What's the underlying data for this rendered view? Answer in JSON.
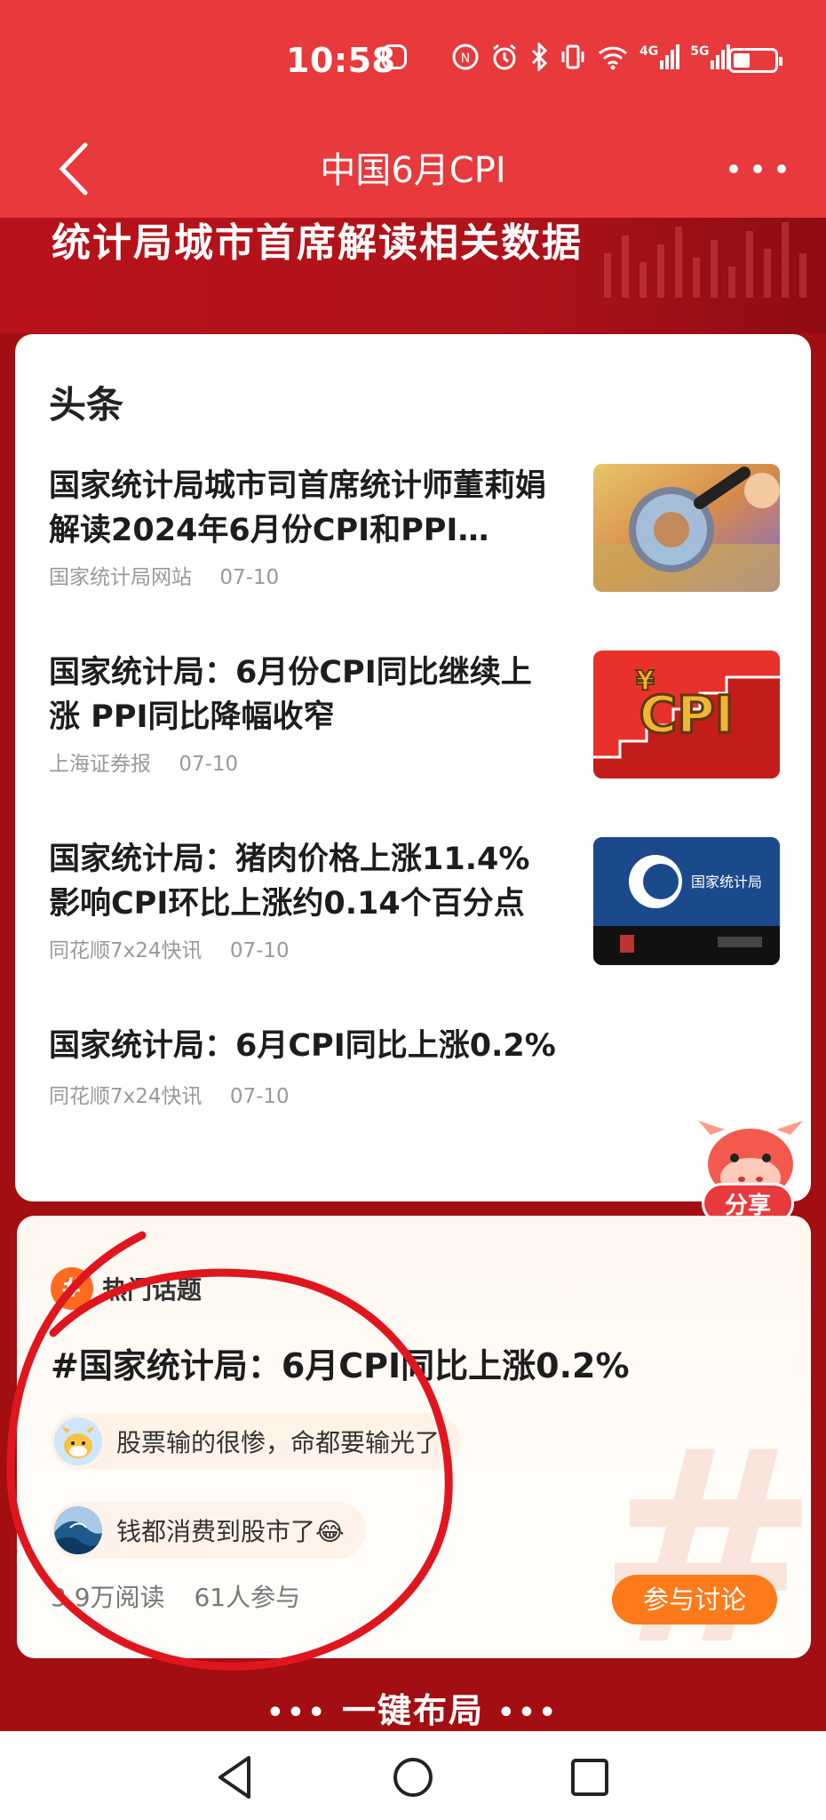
{
  "status_bar": {
    "time": "10:58",
    "icons": [
      "wechat-notification-icon",
      "nfc-icon",
      "alarm-icon",
      "bluetooth-icon",
      "vibrate-icon",
      "wifi-icon",
      "4g-signal-icon",
      "5g-signal-icon",
      "battery-icon"
    ],
    "net1": "4G",
    "net2": "5G"
  },
  "header": {
    "title": "中国6月CPI"
  },
  "banner": {
    "text": "统计局城市首席解读相关数据"
  },
  "headlines": {
    "section_title": "头条",
    "items": [
      {
        "title": "国家统计局城市司首席统计师董莉娟解读2024年6月份CPI和PPI…",
        "source": "国家统计局网站",
        "date": "07-10",
        "thumb": "magnifier-on-money-image"
      },
      {
        "title": "国家统计局：6月份CPI同比继续上涨 PPI同比降幅收窄",
        "source": "上海证券报",
        "date": "07-10",
        "thumb": "cpi-stairs-image"
      },
      {
        "title": "国家统计局：猪肉价格上涨11.4% 影响CPI环比上涨约0.14个百分点",
        "source": "同花顺7x24快讯",
        "date": "07-10",
        "thumb": "nbs-press-conference-image",
        "thumb_text": "国家统计局"
      },
      {
        "title": "国家统计局：6月CPI同比上涨0.2%",
        "source": "同花顺7x24快讯",
        "date": "07-10"
      }
    ],
    "share_label": "分享"
  },
  "hot_topic": {
    "badge": "#",
    "label": "热门话题",
    "title": "#国家统计局：6月CPI同比上涨0.2%",
    "comments": [
      {
        "text": "股票输的很惨，命都要输光了",
        "avatar": "cow-avatar"
      },
      {
        "text": "钱都消费到股市了😂",
        "avatar": "wave-avatar"
      }
    ],
    "reads": "3.9万阅读",
    "participants": "61人参与",
    "join_label": "参与讨论"
  },
  "bottom_cta": {
    "dots_left": "•••",
    "text": "一键布局",
    "dots_right": "•••"
  },
  "colors": {
    "accent_red": "#e8393c",
    "page_bg": "#a30e12",
    "orange": "#ff7a1a",
    "annotation_red": "#e0161e"
  }
}
